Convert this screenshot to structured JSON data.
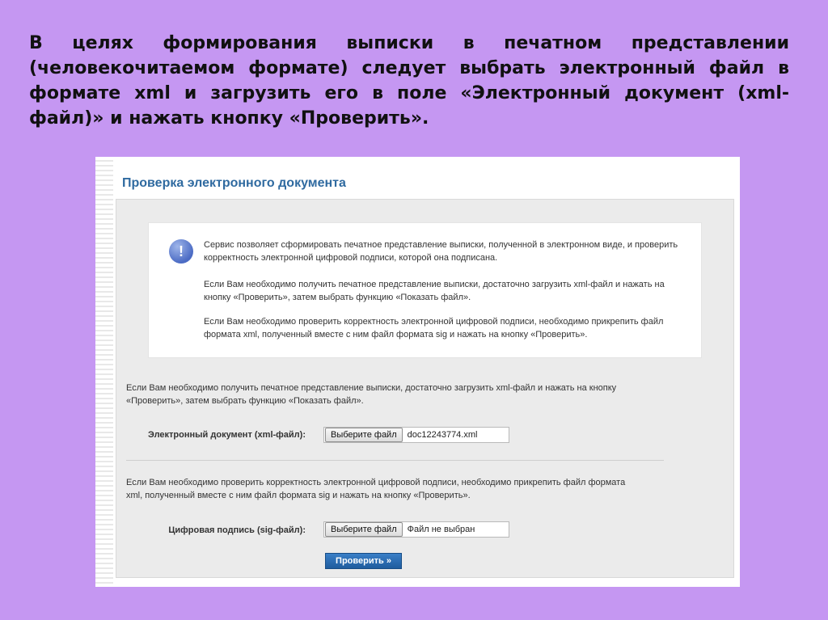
{
  "slide": {
    "lines": [
      "В целях формирования выписки в печатном представлении",
      "(человекочитаемом формате) следует выбрать  электронный файл в",
      "формате xml и загрузить его в поле «Электронный документ (xml-",
      "файл)» и нажать кнопку «Проверить»."
    ]
  },
  "page": {
    "title": "Проверка электронного документа",
    "info": {
      "icon": "exclamation-icon",
      "p1": "Сервис позволяет сформировать печатное представление выписки, полученной в электронном виде, и проверить корректность электронной цифровой подписи, которой она подписана.",
      "p2": "Если Вам необходимо получить печатное представление выписки, достаточно загрузить xml-файл и нажать на кнопку «Проверить», затем выбрать функцию «Показать файл».",
      "p3": "Если Вам необходимо проверить корректность электронной цифровой подписи, необходимо прикрепить файл формата xml, полученный вместе с ним файл формата sig и нажать на кнопку «Проверить»."
    },
    "section1_text": "Если Вам необходимо получить печатное представление выписки, достаточно загрузить xml-файл и нажать на кнопку «Проверить», затем выбрать функцию «Показать файл».",
    "xml_field": {
      "label": "Электронный документ (xml-файл):",
      "button": "Выберите файл",
      "value": "doc12243774.xml"
    },
    "section2_text": "Если Вам необходимо проверить корректность электронной цифровой подписи, необходимо прикрепить файл формата xml, полученный вместе с ним файл формата sig и нажать на кнопку «Проверить».",
    "sig_field": {
      "label": "Цифровая подпись (sig-файл):",
      "button": "Выберите файл",
      "value": "Файл не выбран"
    },
    "submit_label": "Проверить »"
  },
  "colors": {
    "slide_bg": "#c597f2",
    "title": "#2f6aa0",
    "button": "#2a6db5"
  }
}
